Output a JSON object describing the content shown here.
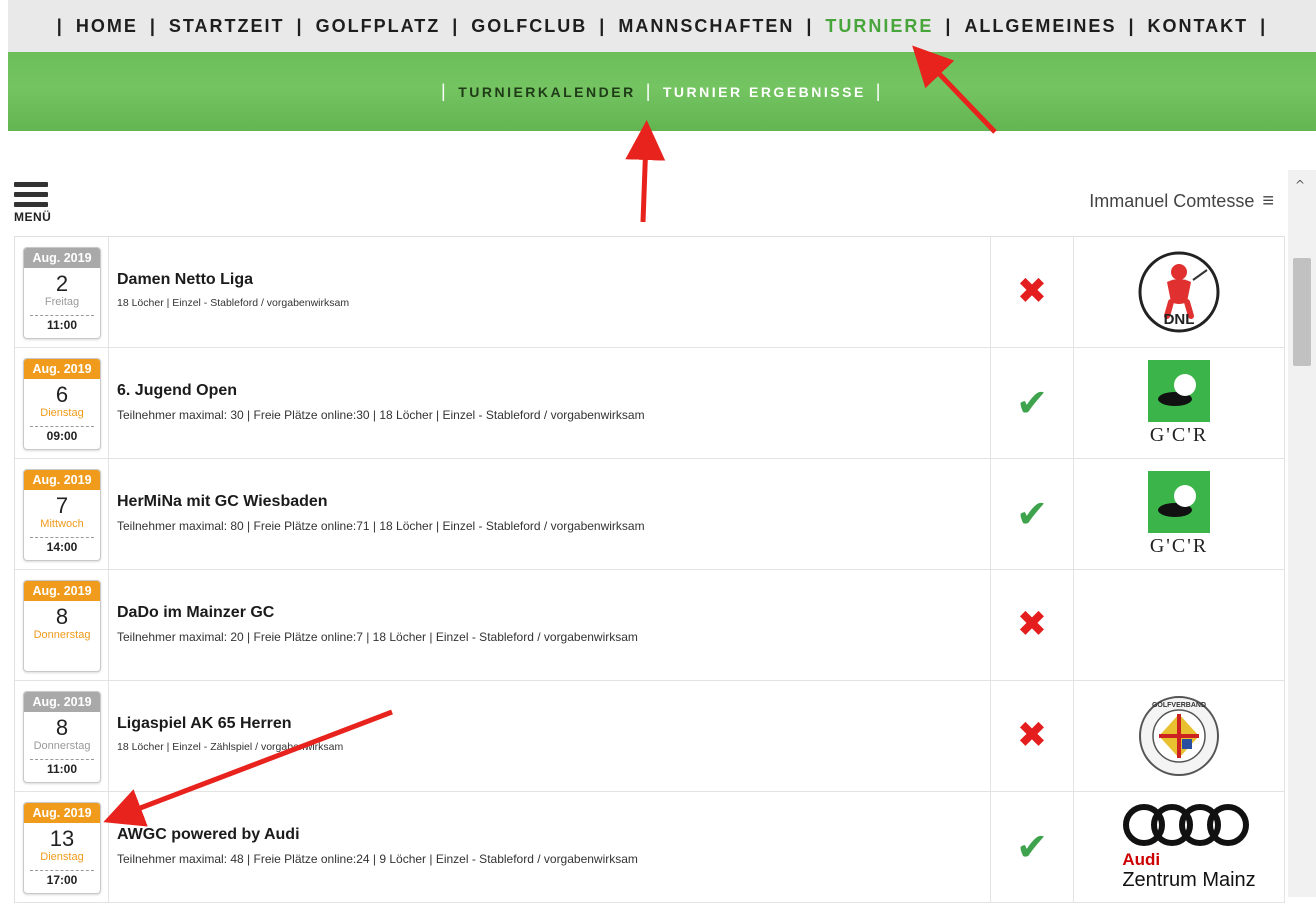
{
  "nav": {
    "items": [
      {
        "label": "HOME",
        "active": false
      },
      {
        "label": "STARTZEIT",
        "active": false
      },
      {
        "label": "GOLFPLATZ",
        "active": false
      },
      {
        "label": "GOLFCLUB",
        "active": false
      },
      {
        "label": "MANNSCHAFTEN",
        "active": false
      },
      {
        "label": "TURNIERE",
        "active": true
      },
      {
        "label": "ALLGEMEINES",
        "active": false
      },
      {
        "label": "KONTAKT",
        "active": false
      }
    ],
    "separator": "|"
  },
  "subnav": {
    "items": [
      {
        "label": "TURNIERKALENDER",
        "style": "dark"
      },
      {
        "label": "TURNIER ERGEBNISSE",
        "style": "light"
      }
    ],
    "separator": "|"
  },
  "toolbar": {
    "menu_label": "MENÜ",
    "user_name": "Immanuel Comtesse"
  },
  "colors": {
    "accent_green": "#48a53b",
    "banner_green": "#6bbf5a",
    "past_header": "#a9a9a9",
    "future_header": "#f09b1b",
    "status_open": "#3fa34d",
    "status_closed": "#e41e1e",
    "annotation_arrow": "#e8231e"
  },
  "tournaments": [
    {
      "month": "Aug. 2019",
      "day": "2",
      "weekday": "Freitag",
      "time": "11:00",
      "past": true,
      "title": "Damen Netto Liga",
      "details": "18 Löcher | Einzel - Stableford / vorgabenwirksam",
      "registration_open": false,
      "logo": "dnl-logo",
      "logo_text": "DNL"
    },
    {
      "month": "Aug. 2019",
      "day": "6",
      "weekday": "Dienstag",
      "time": "09:00",
      "past": false,
      "title": "6. Jugend Open",
      "details": "Teilnehmer maximal: 30 | Freie Plätze online:30 | 18 Löcher | Einzel - Stableford / vorgabenwirksam",
      "registration_open": true,
      "logo": "gcr-logo",
      "logo_text": "G'C'R"
    },
    {
      "month": "Aug. 2019",
      "day": "7",
      "weekday": "Mittwoch",
      "time": "14:00",
      "past": false,
      "title": "HerMiNa mit GC Wiesbaden",
      "details": "Teilnehmer maximal: 80 | Freie Plätze online:71 | 18 Löcher | Einzel - Stableford / vorgabenwirksam",
      "registration_open": true,
      "logo": "gcr-logo",
      "logo_text": "G'C'R"
    },
    {
      "month": "Aug. 2019",
      "day": "8",
      "weekday": "Donnerstag",
      "time": "",
      "past": false,
      "title": "DaDo im Mainzer GC",
      "details": "Teilnehmer maximal: 20 | Freie Plätze online:7 | 18 Löcher | Einzel - Stableford / vorgabenwirksam",
      "registration_open": false,
      "logo": "",
      "logo_text": ""
    },
    {
      "month": "Aug. 2019",
      "day": "8",
      "weekday": "Donnerstag",
      "time": "11:00",
      "past": true,
      "title": "Ligaspiel AK 65 Herren",
      "details": "18 Löcher | Einzel - Zählspiel / vorgabenwirksam",
      "registration_open": false,
      "logo": "golfverband-logo",
      "logo_text": "GOLFVERBAND"
    },
    {
      "month": "Aug. 2019",
      "day": "13",
      "weekday": "Dienstag",
      "time": "17:00",
      "past": false,
      "title": "AWGC powered by Audi",
      "details": "Teilnehmer maximal: 48 | Freie Plätze online:24 | 9 Löcher | Einzel - Stableford / vorgabenwirksam",
      "registration_open": true,
      "logo": "audi-logo",
      "logo_text": "Audi",
      "logo_subtext": "Zentrum Mainz"
    }
  ]
}
